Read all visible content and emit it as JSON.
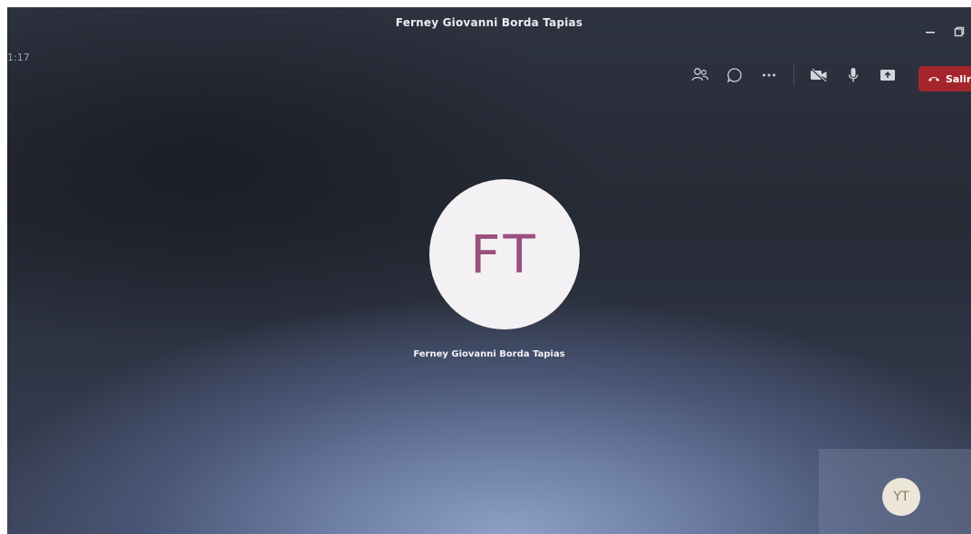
{
  "window": {
    "title": "Ferney Giovanni Borda Tapias"
  },
  "call": {
    "timer": "1:17"
  },
  "toolbar": {
    "icons": [
      "participants-icon",
      "chat-icon",
      "more-options-icon",
      "camera-off-icon",
      "microphone-icon",
      "share-screen-icon"
    ],
    "leave_label": "Salir",
    "leave_color": "#a4262c"
  },
  "main_participant": {
    "initials": "FT",
    "name": "Ferney Giovanni Borda Tapias",
    "avatar_color": "#9b4f7e"
  },
  "self_view": {
    "initials": "YT"
  }
}
